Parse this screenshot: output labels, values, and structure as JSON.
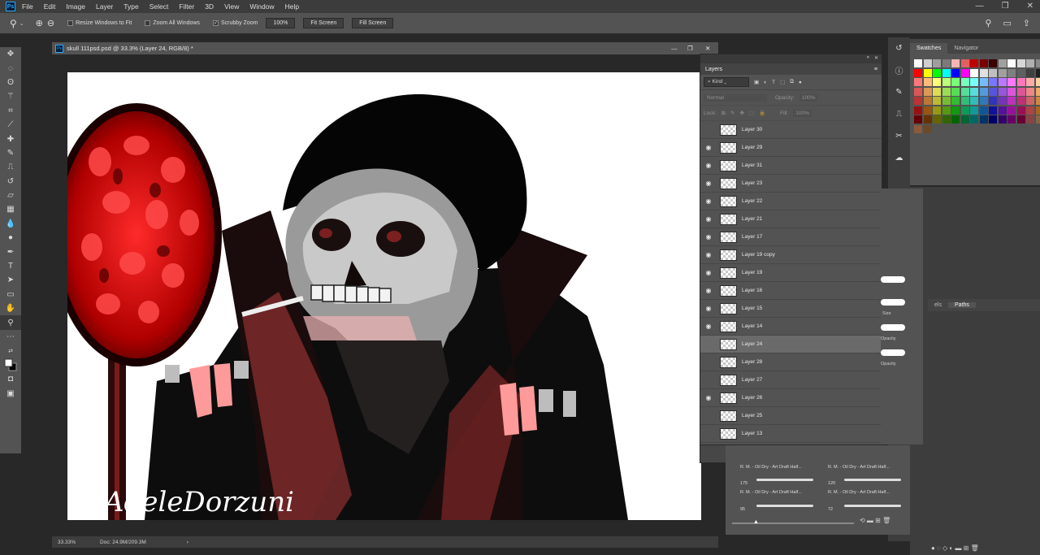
{
  "menubar": {
    "items": [
      "File",
      "Edit",
      "Image",
      "Layer",
      "Type",
      "Select",
      "Filter",
      "3D",
      "View",
      "Window",
      "Help"
    ]
  },
  "options": {
    "resize_windows": "Resize Windows to Fit",
    "zoom_all": "Zoom All Windows",
    "scrubby_zoom": "Scrubby Zoom",
    "zoom_value": "100%",
    "fit_screen": "Fit Screen",
    "fill_screen": "Fill Screen"
  },
  "document": {
    "tab_title": "skull 111psd.psd @ 33.3% (Layer 24, RGB/8) *",
    "signature": "AdeleDorzuni"
  },
  "status": {
    "zoom": "33.33%",
    "doc": "Doc: 24.9M/209.3M",
    "arrow": "›"
  },
  "layers": {
    "title": "Layers",
    "kind": "Kind",
    "blend_mode": "Normal",
    "opacity_label": "Opacity:",
    "opacity_value": "100%",
    "lock_label": "Lock:",
    "fill_label": "Fill:",
    "fill_value": "100%",
    "items": [
      {
        "name": "Layer 30",
        "visible": false,
        "selected": false
      },
      {
        "name": "Layer 29",
        "visible": true,
        "selected": false
      },
      {
        "name": "Layer 31",
        "visible": true,
        "selected": false
      },
      {
        "name": "Layer 23",
        "visible": true,
        "selected": false
      },
      {
        "name": "Layer 22",
        "visible": true,
        "selected": false
      },
      {
        "name": "Layer 21",
        "visible": true,
        "selected": false
      },
      {
        "name": "Layer 17",
        "visible": true,
        "selected": false
      },
      {
        "name": "Layer 19 copy",
        "visible": true,
        "selected": false
      },
      {
        "name": "Layer 19",
        "visible": true,
        "selected": false
      },
      {
        "name": "Layer 16",
        "visible": true,
        "selected": false
      },
      {
        "name": "Layer 15",
        "visible": true,
        "selected": false
      },
      {
        "name": "Layer 14",
        "visible": true,
        "selected": false
      },
      {
        "name": "Layer 24",
        "visible": false,
        "selected": true
      },
      {
        "name": "Layer 28",
        "visible": false,
        "selected": false
      },
      {
        "name": "Layer 27",
        "visible": false,
        "selected": false
      },
      {
        "name": "Layer 26",
        "visible": true,
        "selected": false
      },
      {
        "name": "Layer 25",
        "visible": false,
        "selected": false
      },
      {
        "name": "Layer 13",
        "visible": false,
        "selected": false
      }
    ]
  },
  "swatches": {
    "tabs": [
      "Swatches",
      "Navigator"
    ]
  },
  "brushes": {
    "labels": [
      "R. M. - Oil Dry - Art Draft Half...",
      "R. M. - Oil Dry - Art Draft Half...",
      "R. M. - Oil Dry - Art Draft Half...",
      "R. M. - Oil Dry - Art Draft Half..."
    ],
    "sizes": [
      "175",
      "120",
      "95",
      "72"
    ],
    "side_labels": [
      "Size",
      "Opacity",
      "Opacity"
    ]
  },
  "paths": {
    "tabs": [
      "els",
      "Paths"
    ]
  }
}
